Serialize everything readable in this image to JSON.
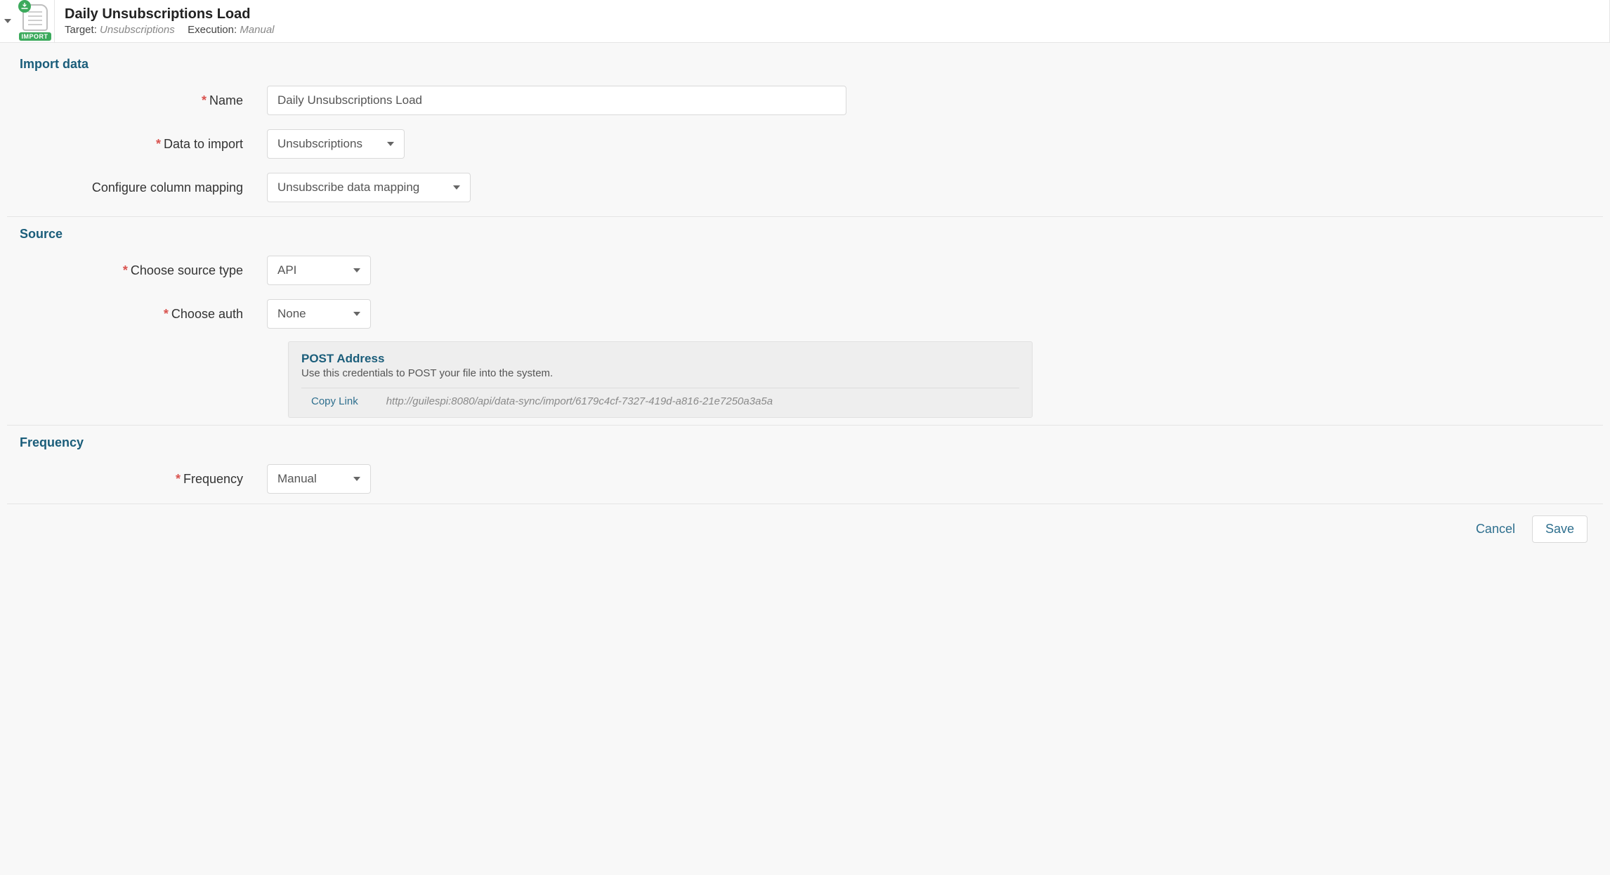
{
  "header": {
    "title": "Daily Unsubscriptions Load",
    "target_label": "Target:",
    "target_value": "Unsubscriptions",
    "execution_label": "Execution:",
    "execution_value": "Manual",
    "badge_text": "IMPORT"
  },
  "sections": {
    "import_data": {
      "title": "Import data",
      "name_label": "Name",
      "name_value": "Daily Unsubscriptions Load",
      "data_to_import_label": "Data to import",
      "data_to_import_value": "Unsubscriptions",
      "mapping_label": "Configure column mapping",
      "mapping_value": "Unsubscribe data mapping"
    },
    "source": {
      "title": "Source",
      "type_label": "Choose source type",
      "type_value": "API",
      "auth_label": "Choose auth",
      "auth_value": "None",
      "post_title": "POST Address",
      "post_desc": "Use this credentials to POST your file into the system.",
      "copy_link_label": "Copy Link",
      "post_url": "http://guilespi:8080/api/data-sync/import/6179c4cf-7327-419d-a816-21e7250a3a5a"
    },
    "frequency": {
      "title": "Frequency",
      "label": "Frequency",
      "value": "Manual"
    }
  },
  "actions": {
    "cancel": "Cancel",
    "save": "Save"
  }
}
